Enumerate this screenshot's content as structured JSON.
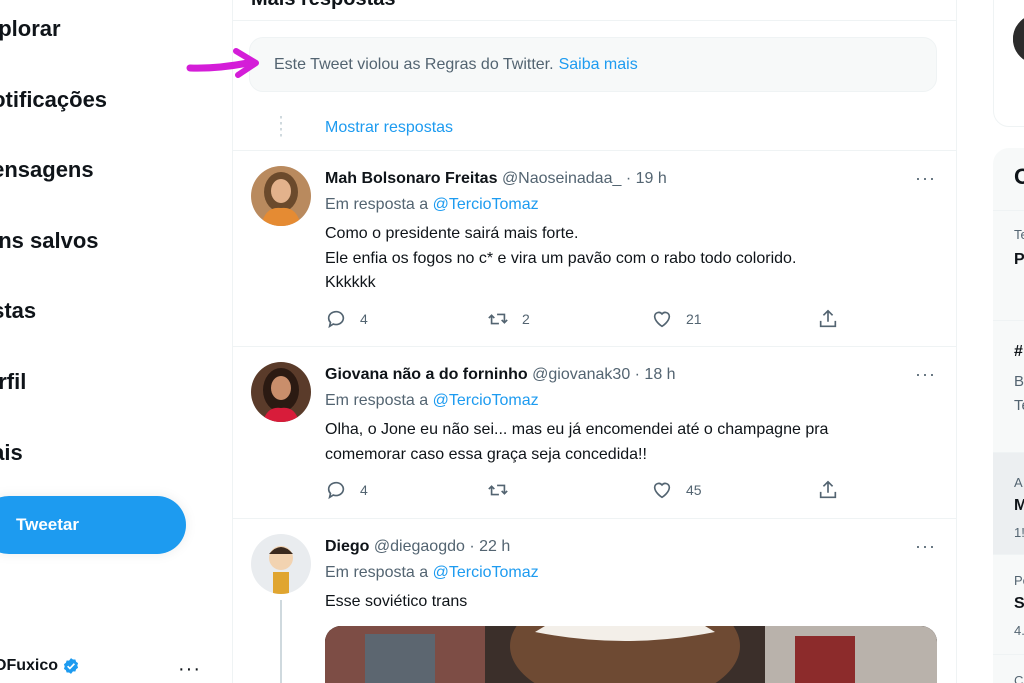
{
  "nav": {
    "items": [
      "xplorar",
      "lotificações",
      "lensagens",
      "ens salvos",
      "istas",
      "erfil",
      "lais"
    ],
    "tweet_button": "Tweetar",
    "account_name": "OFuxico",
    "account_more": "···"
  },
  "timeline": {
    "section_title": "Mais respostas",
    "violation_text": "Este Tweet violou as Regras do Twitter.",
    "violation_link": "Saiba mais",
    "show_replies": "Mostrar respostas",
    "more_glyph": "···",
    "tweets": [
      {
        "name": "Mah Bolsonaro Freitas",
        "meta": "@Naoseinadaa_ · 19 h",
        "reply_prefix": "Em resposta a",
        "reply_handle": "@TercioTomaz",
        "lines": [
          "Como o presidente sairá mais forte.",
          "Ele enfia os fogos no c* e vira um pavão com o rabo todo colorido.",
          "Kkkkkk"
        ],
        "replies": "4",
        "retweets": "2",
        "likes": "21"
      },
      {
        "name": "Giovana não a do forninho",
        "meta": "@giovanak30 · 18 h",
        "reply_prefix": "Em resposta a",
        "reply_handle": "@TercioTomaz",
        "lines": [
          "Olha, o Jone eu não sei... mas eu já encomendei até o champagne pra",
          "comemorar caso essa graça seja concedida!!"
        ],
        "replies": "4",
        "retweets": "",
        "likes": "45"
      },
      {
        "name": "Diego",
        "meta": "@diegaogdo · 22 h",
        "reply_prefix": "Em resposta a",
        "reply_handle": "@TercioTomaz",
        "lines": [
          "Esse soviético trans"
        ]
      }
    ]
  },
  "sidebar": {
    "trends_heading": "O",
    "trends": [
      {
        "top": "Te",
        "main": "P"
      },
      {
        "top": "#",
        "mid": "B",
        "bottom": "Te"
      },
      {
        "top": "A",
        "main": "M",
        "bottom": "1!"
      },
      {
        "top": "Pe",
        "main": "S",
        "bottom": "4."
      },
      {
        "top": "C"
      }
    ]
  },
  "colors": {
    "accent": "#1d9bf0",
    "secondary_text": "#536471",
    "primary_text": "#0f1419",
    "annotation": "#d41dd8"
  }
}
